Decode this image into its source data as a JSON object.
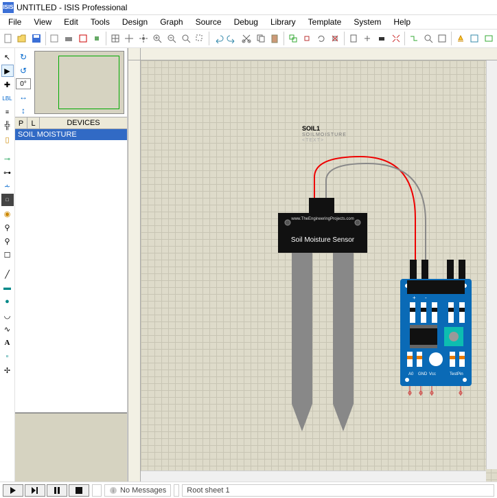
{
  "title": "UNTITLED - ISIS Professional",
  "menu": [
    "File",
    "View",
    "Edit",
    "Tools",
    "Design",
    "Graph",
    "Source",
    "Debug",
    "Library",
    "Template",
    "System",
    "Help"
  ],
  "angle_input": "0°",
  "devices": {
    "header_p": "P",
    "header_l": "L",
    "header_label": "DEVICES",
    "items": [
      "SOIL MOISTURE"
    ]
  },
  "component": {
    "ref": "SOIL1",
    "name": "SOILMOISTURE",
    "text": "<TEXT>",
    "sensor_title": "Soil Moisture Sensor",
    "sensor_url": "www.TheEngineeringProjects.com",
    "pins": {
      "plus": "+",
      "minus": "-",
      "a0": "A0",
      "gnd": "GND",
      "vcc": "Vcc",
      "test": "TestPin"
    }
  },
  "status": {
    "no_messages": "No Messages",
    "sheet": "Root sheet 1"
  }
}
